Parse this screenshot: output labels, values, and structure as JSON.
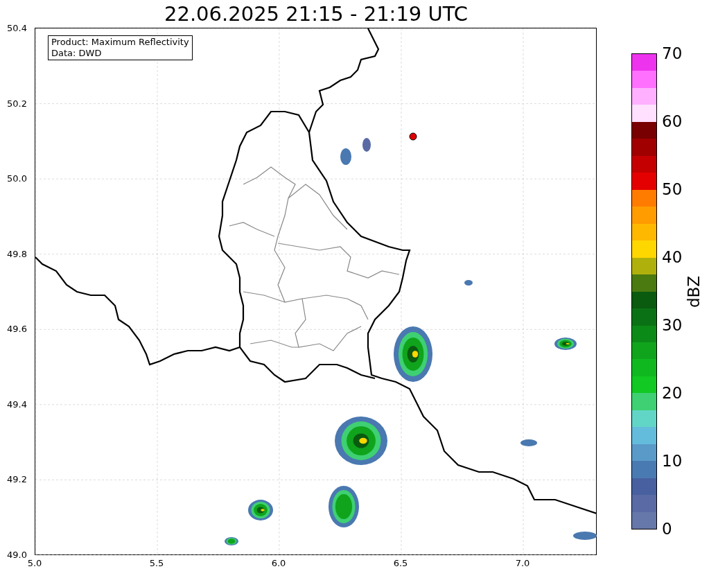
{
  "title": "22.06.2025 21:15 - 21:19 UTC",
  "info_box": {
    "lines": [
      "Product: Maximum Reflectivity",
      "Data: DWD"
    ]
  },
  "map": {
    "x_ticks": [
      "5.0",
      "5.5",
      "6.0",
      "6.5",
      "7.0"
    ],
    "y_ticks": [
      "50.4",
      "50.2",
      "50.0",
      "49.8",
      "49.6",
      "49.4",
      "49.2",
      "49.0"
    ]
  },
  "colorbar": {
    "label": "dBZ",
    "ticks": [
      "70",
      "60",
      "50",
      "40",
      "30",
      "20",
      "10",
      "0"
    ],
    "segments": [
      {
        "color": "#ee33ee"
      },
      {
        "color": "#ff70ff"
      },
      {
        "color": "#ffb0ff"
      },
      {
        "color": "#ffe0ff"
      },
      {
        "color": "#780000"
      },
      {
        "color": "#a00000"
      },
      {
        "color": "#c40000"
      },
      {
        "color": "#e40000"
      },
      {
        "color": "#ff7c00"
      },
      {
        "color": "#ff9c00"
      },
      {
        "color": "#ffb800"
      },
      {
        "color": "#ffd700"
      },
      {
        "color": "#b0b00c"
      },
      {
        "color": "#4a7a10"
      },
      {
        "color": "#0a5a10"
      },
      {
        "color": "#0a7214"
      },
      {
        "color": "#0c8a18"
      },
      {
        "color": "#10a41c"
      },
      {
        "color": "#10b820"
      },
      {
        "color": "#12c822"
      },
      {
        "color": "#3ed072"
      },
      {
        "color": "#62d6c6"
      },
      {
        "color": "#64bcdc"
      },
      {
        "color": "#5a9ac8"
      },
      {
        "color": "#4a7ab2"
      },
      {
        "color": "#4860a0"
      },
      {
        "color": "#5a6aa4"
      },
      {
        "color": "#6677aa"
      }
    ]
  }
}
